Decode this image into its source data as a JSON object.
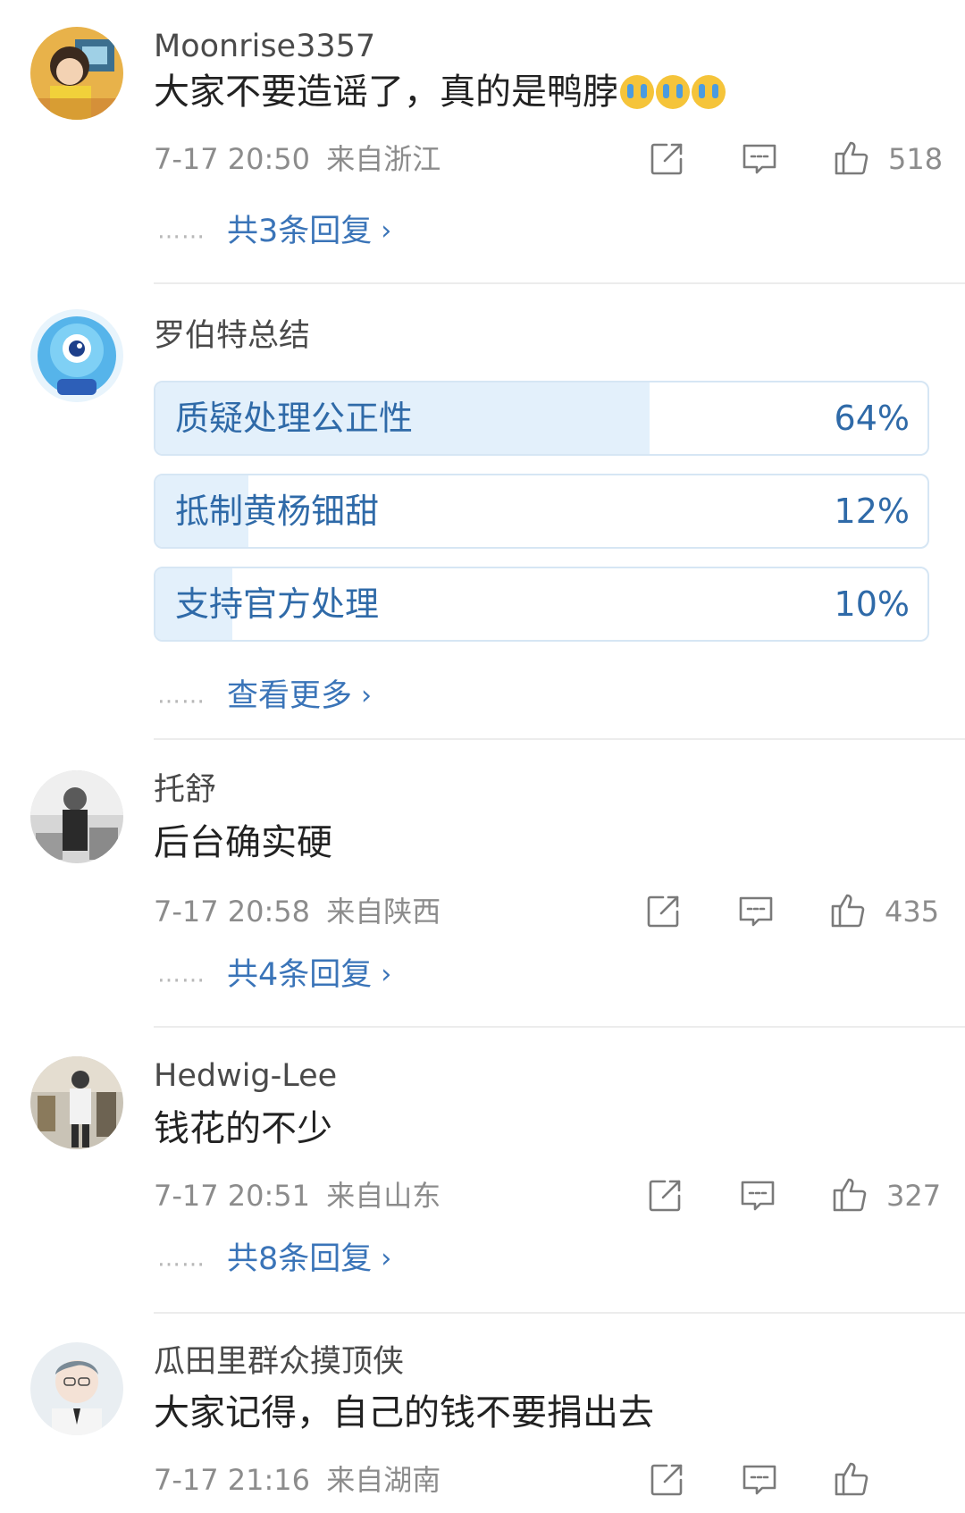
{
  "comments": [
    {
      "username": "Moonrise3357",
      "text": "大家不要造谣了，真的是鸭脖",
      "emoji": [
        "crying-emoji",
        "crying-emoji",
        "crying-emoji"
      ],
      "time": "7-17 20:50",
      "location": "来自浙江",
      "likes": "518",
      "reply_link": "共3条回复"
    },
    {
      "username": "托舒",
      "text": "后台确实硬",
      "time": "7-17 20:58",
      "location": "来自陕西",
      "likes": "435",
      "reply_link": "共4条回复"
    },
    {
      "username": "Hedwig-Lee",
      "text": "钱花的不少",
      "time": "7-17 20:51",
      "location": "来自山东",
      "likes": "327",
      "reply_link": "共8条回复"
    },
    {
      "username": "瓜田里群众摸顶侠",
      "text": "大家记得，自己的钱不要捐出去",
      "time": "7-17 21:16",
      "location": "来自湖南"
    }
  ],
  "poll": {
    "username": "罗伯特总结",
    "options": [
      {
        "label": "质疑处理公正性",
        "percent": "64%",
        "fraction": 0.64
      },
      {
        "label": "抵制黄杨钿甜",
        "percent": "12%",
        "fraction": 0.12
      },
      {
        "label": "支持官方处理",
        "percent": "10%",
        "fraction": 0.1
      }
    ],
    "more_link": "查看更多"
  },
  "ui": {
    "dots": "……",
    "chevron": "›"
  },
  "icons": {
    "repost": "repost-icon",
    "comment": "comment-icon",
    "like": "like-icon"
  },
  "colors": {
    "link": "#3a74b8",
    "poll_fill": "#e3f0fb",
    "poll_border": "#d6e6f4",
    "meta": "#8c8c8c"
  }
}
